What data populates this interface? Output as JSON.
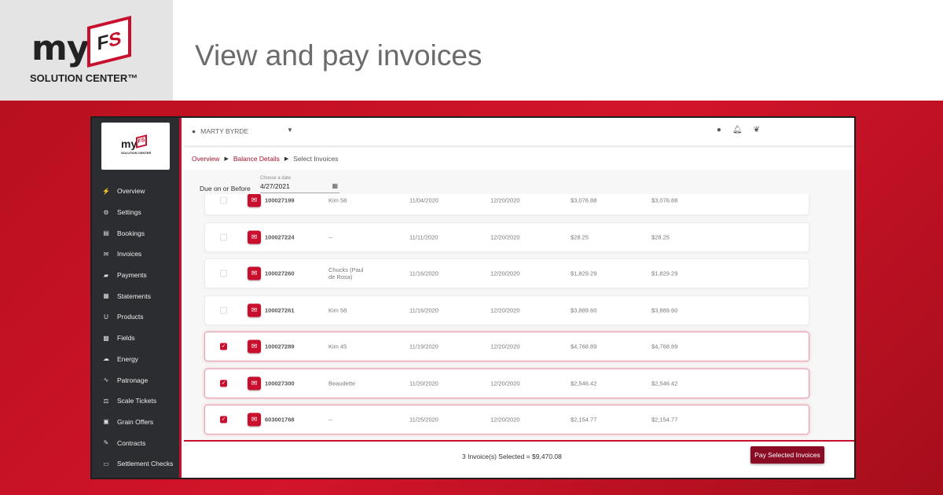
{
  "banner": {
    "logo_text": "myFS",
    "logo_sub": "SOLUTION CENTER™",
    "headline": "View and pay invoices"
  },
  "app": {
    "sidebar_logo": {
      "my": "my",
      "fs": "FS",
      "sub": "SOLUTION CENTER"
    },
    "nav": [
      {
        "label": "Overview",
        "icon": "⚡"
      },
      {
        "label": "Settings",
        "icon": "⚙"
      },
      {
        "label": "Bookings",
        "icon": "▤"
      },
      {
        "label": "Invoices",
        "icon": "✉"
      },
      {
        "label": "Payments",
        "icon": "▰"
      },
      {
        "label": "Statements",
        "icon": "▦"
      },
      {
        "label": "Products",
        "icon": "U"
      },
      {
        "label": "Fields",
        "icon": "▩"
      },
      {
        "label": "Energy",
        "icon": "☁"
      },
      {
        "label": "Patronage",
        "icon": "∿"
      },
      {
        "label": "Scale Tickets",
        "icon": "⚖"
      },
      {
        "label": "Grain Offers",
        "icon": "▣"
      },
      {
        "label": "Contracts",
        "icon": "✎"
      },
      {
        "label": "Settlement Checks",
        "icon": "▭"
      }
    ],
    "user": "MARTY BYRDE",
    "header_icons": [
      "info-icon",
      "bell-icon",
      "leaf-icon"
    ],
    "breadcrumb": {
      "overview": "Overview",
      "balance": "Balance Details",
      "current": "Select Invoices"
    },
    "filter": {
      "label": "Due on or Before",
      "caption": "Choose a date",
      "value": "4/27/2021"
    },
    "invoices": [
      {
        "id": "100027199",
        "name": "Kim 58",
        "date": "11/04/2020",
        "due": "12/20/2020",
        "amount": "$3,076.88",
        "balance": "$3,076.88",
        "selected": false
      },
      {
        "id": "100027224",
        "name": "--",
        "date": "11/11/2020",
        "due": "12/20/2020",
        "amount": "$28.25",
        "balance": "$28.25",
        "selected": false
      },
      {
        "id": "100027260",
        "name": "Chucks (Paul de Rosa)",
        "date": "11/16/2020",
        "due": "12/20/2020",
        "amount": "$1,829.29",
        "balance": "$1,829.29",
        "selected": false
      },
      {
        "id": "100027261",
        "name": "Kim 58",
        "date": "11/16/2020",
        "due": "12/20/2020",
        "amount": "$3,889.60",
        "balance": "$3,889.60",
        "selected": false
      },
      {
        "id": "100027289",
        "name": "Kim 45",
        "date": "11/19/2020",
        "due": "12/20/2020",
        "amount": "$4,768.89",
        "balance": "$4,768.89",
        "selected": true
      },
      {
        "id": "100027300",
        "name": "Beaudette",
        "date": "11/20/2020",
        "due": "12/20/2020",
        "amount": "$2,546.42",
        "balance": "$2,546.42",
        "selected": true
      },
      {
        "id": "603001768",
        "name": "--",
        "date": "11/25/2020",
        "due": "12/20/2020",
        "amount": "$2,154.77",
        "balance": "$2,154.77",
        "selected": true
      }
    ],
    "footer": {
      "summary": "3 Invoice(s) Selected = $9,470.08",
      "pay_label": "Pay Selected Invoices"
    },
    "accent": "#c8102e"
  }
}
